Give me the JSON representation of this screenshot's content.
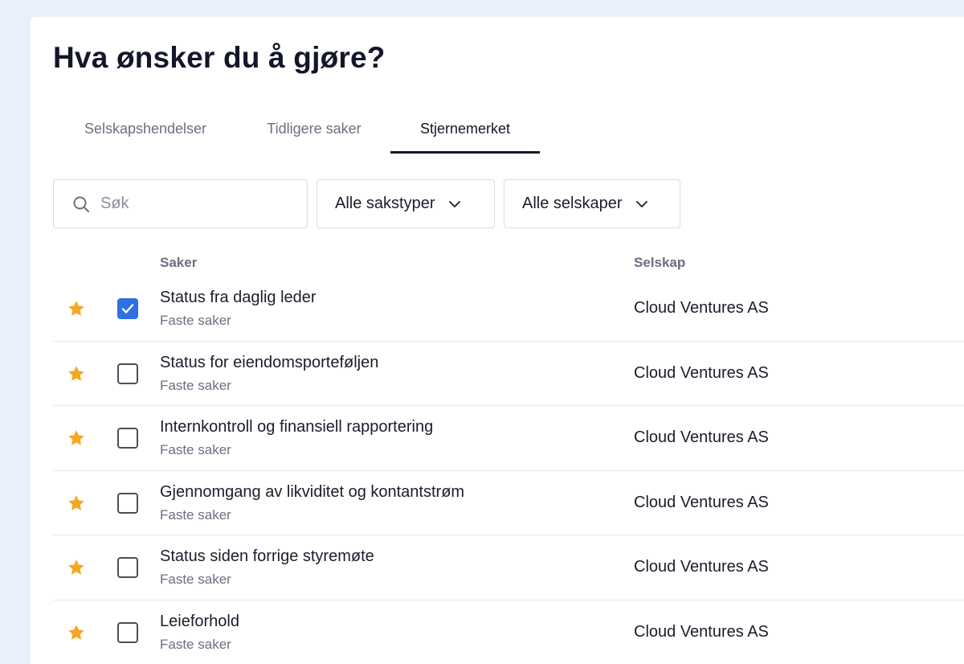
{
  "page": {
    "title": "Hva ønsker du å gjøre?"
  },
  "tabs": [
    {
      "label": "Selskapshendelser",
      "active": false
    },
    {
      "label": "Tidligere saker",
      "active": false
    },
    {
      "label": "Stjernemerket",
      "active": true
    }
  ],
  "filters": {
    "search_placeholder": "Søk",
    "search_value": "",
    "type_select": "Alle sakstyper",
    "company_select": "Alle selskaper"
  },
  "table": {
    "columns": {
      "cases": "Saker",
      "company": "Selskap"
    },
    "rows": [
      {
        "starred": true,
        "checked": true,
        "title": "Status fra daglig leder",
        "subtitle": "Faste saker",
        "company": "Cloud Ventures AS"
      },
      {
        "starred": true,
        "checked": false,
        "title": "Status for eiendomsporteføljen",
        "subtitle": "Faste saker",
        "company": "Cloud Ventures AS"
      },
      {
        "starred": true,
        "checked": false,
        "title": "Internkontroll og finansiell rapportering",
        "subtitle": "Faste saker",
        "company": "Cloud Ventures AS"
      },
      {
        "starred": true,
        "checked": false,
        "title": "Gjennomgang av likviditet og kontantstrøm",
        "subtitle": "Faste saker",
        "company": "Cloud Ventures AS"
      },
      {
        "starred": true,
        "checked": false,
        "title": "Status siden forrige styremøte",
        "subtitle": "Faste saker",
        "company": "Cloud Ventures AS"
      },
      {
        "starred": true,
        "checked": false,
        "title": "Leieforhold",
        "subtitle": "Faste saker",
        "company": "Cloud Ventures AS"
      }
    ]
  },
  "icons": {
    "search": "search-icon",
    "dropdown": "chevron-down-icon",
    "star": "star-icon",
    "check": "check-icon"
  },
  "colors": {
    "star": "#f5a623",
    "checkbox_checked": "#2f6fe4",
    "accent_text": "#14162a",
    "muted_text": "#6b6f80",
    "background": "#e9f0fb"
  }
}
